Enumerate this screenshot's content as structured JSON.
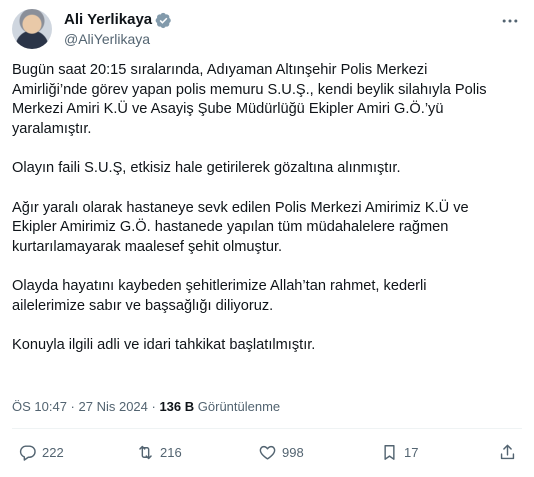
{
  "author": {
    "display_name": "Ali Yerlikaya",
    "handle": "@AliYerlikaya",
    "verified_color": "#829aab"
  },
  "body": {
    "paragraphs": [
      [
        "Bugün saat 20:15 sıralarında, Adıyaman Altınşehir Polis Merkezi",
        "Amirliği’nde görev yapan polis memuru S.U.Ş., kendi beylik silahıyla Polis",
        "Merkezi Amiri K.Ü ve Asayiş Şube Müdürlüğü Ekipler Amiri G.Ö.’yü",
        "yaralamıştır."
      ],
      [
        "Olayın faili S.U.Ş, etkisiz hale getirilerek  gözaltına alınmıştır."
      ],
      [
        "Ağır yaralı olarak hastaneye sevk edilen Polis Merkezi Amirimiz K.Ü ve",
        "Ekipler Amirimiz G.Ö. hastanede yapılan tüm müdahalelere rağmen",
        "kurtarılamayarak maalesef şehit olmuştur."
      ],
      [
        "Olayda hayatını kaybeden şehitlerimize Allah’tan rahmet, kederli",
        "ailelerimize sabır ve başsağlığı diliyoruz."
      ],
      [
        "Konuyla ilgili adli ve idari tahkikat başlatılmıştır."
      ]
    ]
  },
  "meta": {
    "time": "ÖS 10:47",
    "separator": " · ",
    "date": "27 Nis 2024",
    "views_count": "136 B",
    "views_label": " Görüntülenme"
  },
  "actions": {
    "replies": "222",
    "retweets": "216",
    "likes": "998",
    "bookmarks": "17"
  },
  "icons": {
    "reply": "reply-icon",
    "retweet": "retweet-icon",
    "like": "heart-icon",
    "bookmark": "bookmark-icon",
    "share": "share-icon",
    "more": "more-icon"
  }
}
